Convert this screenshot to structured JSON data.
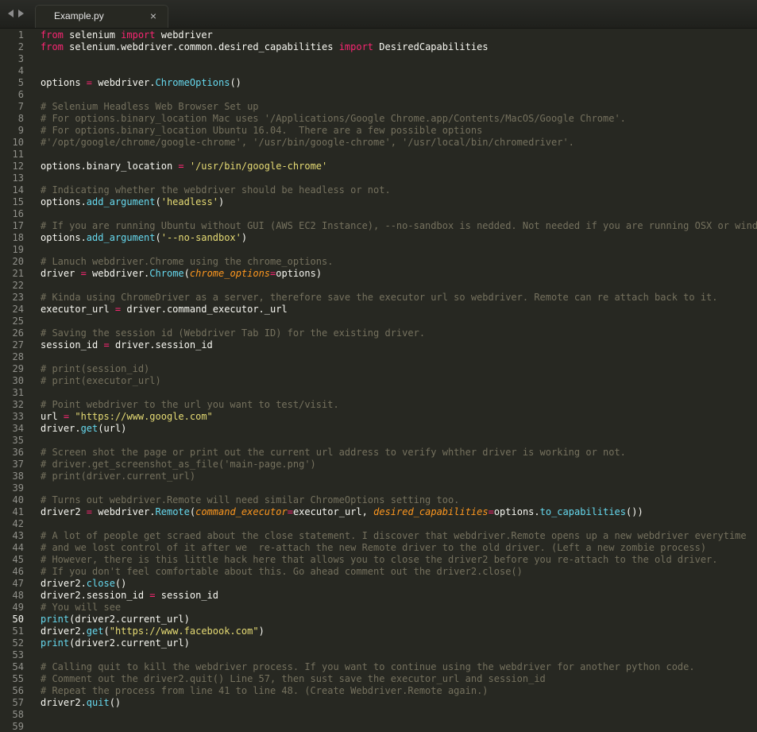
{
  "tabbar": {
    "nav_back_icon": "triangle-left-icon",
    "nav_forward_icon": "triangle-right-icon",
    "tab_title": "Example.py",
    "tab_close": "×"
  },
  "colors": {
    "background": "#272822",
    "keyword": "#f92672",
    "string": "#e6db74",
    "comment": "#75715e",
    "function": "#66d9ef",
    "argument": "#fd971f",
    "text": "#f8f8f2"
  },
  "editor": {
    "active_line": 50,
    "lines": [
      {
        "n": "1",
        "t": [
          [
            "kw",
            "from"
          ],
          [
            "pl",
            " selenium "
          ],
          [
            "kw",
            "import"
          ],
          [
            "pl",
            " webdriver"
          ]
        ]
      },
      {
        "n": "2",
        "t": [
          [
            "kw",
            "from"
          ],
          [
            "pl",
            " selenium.webdriver.common.desired_capabilities "
          ],
          [
            "kw",
            "import"
          ],
          [
            "pl",
            " DesiredCapabilities"
          ]
        ]
      },
      {
        "n": "3",
        "t": []
      },
      {
        "n": "4",
        "t": []
      },
      {
        "n": "5",
        "t": [
          [
            "pl",
            "options "
          ],
          [
            "op",
            "="
          ],
          [
            "pl",
            " webdriver."
          ],
          [
            "fn",
            "ChromeOptions"
          ],
          [
            "pl",
            "()"
          ]
        ]
      },
      {
        "n": "6",
        "t": []
      },
      {
        "n": "7",
        "t": [
          [
            "cm",
            "# Selenium Headless Web Browser Set up"
          ]
        ]
      },
      {
        "n": "8",
        "t": [
          [
            "cm",
            "# For options.binary_location Mac uses '/Applications/Google Chrome.app/Contents/MacOS/Google Chrome'."
          ]
        ]
      },
      {
        "n": "9",
        "t": [
          [
            "cm",
            "# For options.binary_location Ubuntu 16.04.  There are a few possible options"
          ]
        ]
      },
      {
        "n": "10",
        "t": [
          [
            "cm",
            "#'/opt/google/chrome/google-chrome', '/usr/bin/google-chrome', '/usr/local/bin/chromedriver'."
          ]
        ]
      },
      {
        "n": "11",
        "t": []
      },
      {
        "n": "12",
        "t": [
          [
            "pl",
            "options.binary_location "
          ],
          [
            "op",
            "="
          ],
          [
            "pl",
            " "
          ],
          [
            "str",
            "'/usr/bin/google-chrome'"
          ]
        ]
      },
      {
        "n": "13",
        "t": []
      },
      {
        "n": "14",
        "t": [
          [
            "cm",
            "# Indicating whether the webdriver should be headless or not."
          ]
        ]
      },
      {
        "n": "15",
        "t": [
          [
            "pl",
            "options."
          ],
          [
            "fn",
            "add_argument"
          ],
          [
            "pl",
            "("
          ],
          [
            "str",
            "'headless'"
          ],
          [
            "pl",
            ")"
          ]
        ]
      },
      {
        "n": "16",
        "t": []
      },
      {
        "n": "17",
        "t": [
          [
            "cm",
            "# If you are running Ubuntu without GUI (AWS EC2 Instance), --no-sandbox is nedded. Not needed if you are running OSX or window."
          ]
        ]
      },
      {
        "n": "18",
        "t": [
          [
            "pl",
            "options."
          ],
          [
            "fn",
            "add_argument"
          ],
          [
            "pl",
            "("
          ],
          [
            "str",
            "'--no-sandbox'"
          ],
          [
            "pl",
            ")"
          ]
        ]
      },
      {
        "n": "19",
        "t": []
      },
      {
        "n": "20",
        "t": [
          [
            "cm",
            "# Lanuch webdriver.Chrome using the chrome_options."
          ]
        ]
      },
      {
        "n": "21",
        "t": [
          [
            "pl",
            "driver "
          ],
          [
            "op",
            "="
          ],
          [
            "pl",
            " webdriver."
          ],
          [
            "fn",
            "Chrome"
          ],
          [
            "pl",
            "("
          ],
          [
            "arg",
            "chrome_options"
          ],
          [
            "op",
            "="
          ],
          [
            "pl",
            "options)"
          ]
        ]
      },
      {
        "n": "22",
        "t": []
      },
      {
        "n": "23",
        "t": [
          [
            "cm",
            "# Kinda using ChromeDriver as a server, therefore save the executor url so webdriver. Remote can re attach back to it."
          ]
        ]
      },
      {
        "n": "24",
        "t": [
          [
            "pl",
            "executor_url "
          ],
          [
            "op",
            "="
          ],
          [
            "pl",
            " driver.command_executor._url"
          ]
        ]
      },
      {
        "n": "25",
        "t": []
      },
      {
        "n": "26",
        "t": [
          [
            "cm",
            "# Saving the session id (Webdriver Tab ID) for the existing driver."
          ]
        ]
      },
      {
        "n": "27",
        "t": [
          [
            "pl",
            "session_id "
          ],
          [
            "op",
            "="
          ],
          [
            "pl",
            " driver.session_id"
          ]
        ]
      },
      {
        "n": "28",
        "t": []
      },
      {
        "n": "29",
        "t": [
          [
            "cm",
            "# print(session_id)"
          ]
        ]
      },
      {
        "n": "30",
        "t": [
          [
            "cm",
            "# print(executor_url)"
          ]
        ]
      },
      {
        "n": "31",
        "t": []
      },
      {
        "n": "32",
        "t": [
          [
            "cm",
            "# Point webdriver to the url you want to test/visit."
          ]
        ]
      },
      {
        "n": "33",
        "t": [
          [
            "pl",
            "url "
          ],
          [
            "op",
            "="
          ],
          [
            "pl",
            " "
          ],
          [
            "str",
            "\"https://www.google.com\""
          ]
        ]
      },
      {
        "n": "34",
        "t": [
          [
            "pl",
            "driver."
          ],
          [
            "fn",
            "get"
          ],
          [
            "pl",
            "(url)"
          ]
        ]
      },
      {
        "n": "35",
        "t": []
      },
      {
        "n": "36",
        "t": [
          [
            "cm",
            "# Screen shot the page or print out the current url address to verify whther driver is working or not."
          ]
        ]
      },
      {
        "n": "37",
        "t": [
          [
            "cm",
            "# driver.get_screenshot_as_file('main-page.png')"
          ]
        ]
      },
      {
        "n": "38",
        "t": [
          [
            "cm",
            "# print(driver.current_url)"
          ]
        ]
      },
      {
        "n": "39",
        "t": []
      },
      {
        "n": "40",
        "t": [
          [
            "cm",
            "# Turns out webdriver.Remote will need similar ChromeOptions setting too."
          ]
        ]
      },
      {
        "n": "41",
        "t": [
          [
            "pl",
            "driver2 "
          ],
          [
            "op",
            "="
          ],
          [
            "pl",
            " webdriver."
          ],
          [
            "fn",
            "Remote"
          ],
          [
            "pl",
            "("
          ],
          [
            "arg",
            "command_executor"
          ],
          [
            "op",
            "="
          ],
          [
            "pl",
            "executor_url, "
          ],
          [
            "arg",
            "desired_capabilities"
          ],
          [
            "op",
            "="
          ],
          [
            "pl",
            "options."
          ],
          [
            "fn",
            "to_capabilities"
          ],
          [
            "pl",
            "())"
          ]
        ]
      },
      {
        "n": "42",
        "t": []
      },
      {
        "n": "43",
        "t": [
          [
            "cm",
            "# A lot of people get scraed about the close statement. I discover that webdriver.Remote opens up a new webdriver everytime"
          ]
        ]
      },
      {
        "n": "44",
        "t": [
          [
            "cm",
            "# and we lost control of it after we  re-attach the new Remote driver to the old driver. (Left a new zombie process)"
          ]
        ]
      },
      {
        "n": "45",
        "t": [
          [
            "cm",
            "# However, there is this little hack here that allows you to close the driver2 before you re-attach to the old driver."
          ]
        ]
      },
      {
        "n": "46",
        "t": [
          [
            "cm",
            "# If you don't feel comfortable about this. Go ahead comment out the driver2.close()"
          ]
        ]
      },
      {
        "n": "47",
        "t": [
          [
            "pl",
            "driver2."
          ],
          [
            "fn",
            "close"
          ],
          [
            "pl",
            "()"
          ]
        ]
      },
      {
        "n": "48",
        "t": [
          [
            "pl",
            "driver2.session_id "
          ],
          [
            "op",
            "="
          ],
          [
            "pl",
            " session_id"
          ]
        ]
      },
      {
        "n": "49",
        "t": [
          [
            "cm",
            "# You will see"
          ]
        ]
      },
      {
        "n": "50",
        "t": [
          [
            "fn",
            "print"
          ],
          [
            "pl",
            "(driver2.current_url)"
          ]
        ]
      },
      {
        "n": "51",
        "t": [
          [
            "pl",
            "driver2."
          ],
          [
            "fn",
            "get"
          ],
          [
            "pl",
            "("
          ],
          [
            "str",
            "\"https://www.facebook.com\""
          ],
          [
            "pl",
            ")"
          ]
        ]
      },
      {
        "n": "52",
        "t": [
          [
            "fn",
            "print"
          ],
          [
            "pl",
            "(driver2.current_url)"
          ]
        ]
      },
      {
        "n": "53",
        "t": []
      },
      {
        "n": "54",
        "t": [
          [
            "cm",
            "# Calling quit to kill the webdriver process. If you want to continue using the webdriver for another python code."
          ]
        ]
      },
      {
        "n": "55",
        "t": [
          [
            "cm",
            "# Comment out the driver2.quit() Line 57, then sust save the executor_url and session_id"
          ]
        ]
      },
      {
        "n": "56",
        "t": [
          [
            "cm",
            "# Repeat the process from line 41 to line 48. (Create Webdriver.Remote again.)"
          ]
        ]
      },
      {
        "n": "57",
        "t": [
          [
            "pl",
            "driver2."
          ],
          [
            "fn",
            "quit"
          ],
          [
            "pl",
            "()"
          ]
        ]
      },
      {
        "n": "58",
        "t": []
      },
      {
        "n": "59",
        "t": []
      }
    ]
  }
}
